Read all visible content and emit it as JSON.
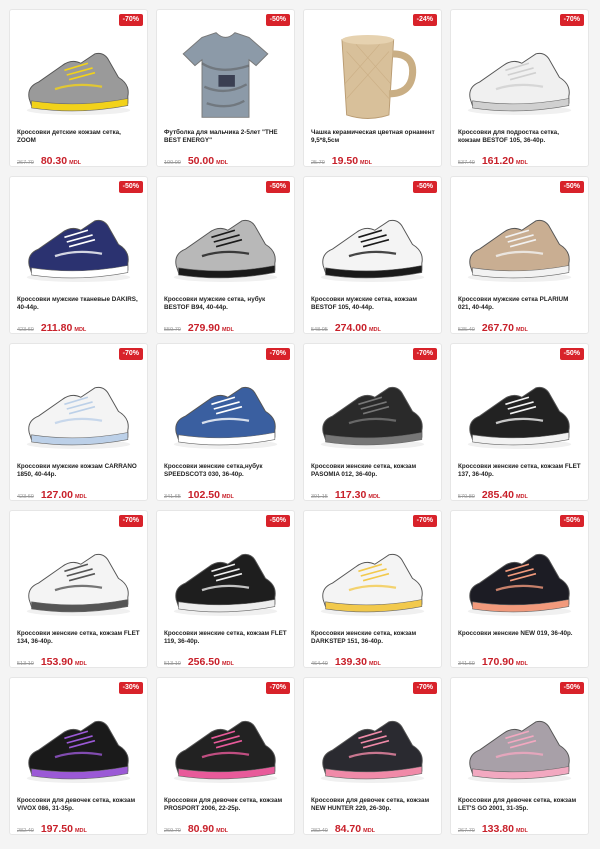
{
  "currency": "MDL",
  "products": [
    {
      "badge": "-70%",
      "title": "Кроссовки детские кожзам сетка, ZOOM",
      "old_price": "267.70",
      "price": "80.30",
      "icon": "kids-sneaker-silver-icon",
      "color": "#9a9a9a",
      "accent": "#f2d21a"
    },
    {
      "badge": "-50%",
      "title": "Футболка для мальчика 2-5лет \"THE BEST ENERGY\"",
      "old_price": "100.00",
      "price": "50.00",
      "icon": "tshirt-icon",
      "color": "#8c9aa8",
      "accent": "#3a3f52"
    },
    {
      "badge": "-24%",
      "title": "Чашка кeрамическая цветная орнамент 9,5*8,5см",
      "old_price": "25.70",
      "price": "19.50",
      "icon": "mug-icon",
      "color": "#d8c09a",
      "accent": "#c9ae84"
    },
    {
      "badge": "-70%",
      "title": "Кроссовки для подростка сетка, кожзам BESTOF 105, 36-40р.",
      "old_price": "537.40",
      "price": "161.20",
      "icon": "sneaker-white-icon",
      "color": "#f0f0f0",
      "accent": "#d0d0d0"
    },
    {
      "badge": "-50%",
      "title": "Кроссовки мужские тканевые DAKIRS, 40-44р.",
      "old_price": "423.60",
      "price": "211.80",
      "icon": "sneaker-navy-icon",
      "color": "#2b3270",
      "accent": "#ffffff"
    },
    {
      "badge": "-50%",
      "title": "Кроссовки мужские сетка, нубук BESTOF B94, 40-44р.",
      "old_price": "559.70",
      "price": "279.90",
      "icon": "sneaker-grey-black-icon",
      "color": "#b8b8b8",
      "accent": "#1a1a1a"
    },
    {
      "badge": "-50%",
      "title": "Кроссовки мужские сетка, кожзам BESTOF 105, 40-44р.",
      "old_price": "548.05",
      "price": "274.00",
      "icon": "sneaker-white-black-icon",
      "color": "#f4f4f4",
      "accent": "#1a1a1a"
    },
    {
      "badge": "-50%",
      "title": "Кроссовки мужские сетка PLARIUM 021, 40-44р.",
      "old_price": "535.40",
      "price": "267.70",
      "icon": "sneaker-beige-icon",
      "color": "#c9ae92",
      "accent": "#f2f2f2"
    },
    {
      "badge": "-70%",
      "title": "Кроссовки мужские кожзам CARRANO 1850, 40-44р.",
      "old_price": "423.60",
      "price": "127.00",
      "icon": "sneaker-white-chunky-icon",
      "color": "#f4f4f4",
      "accent": "#bcd0e8"
    },
    {
      "badge": "-70%",
      "title": "Кроссовки женские сетка,нубук SPEEDSCOT3 030, 36-40р.",
      "old_price": "341.65",
      "price": "102.50",
      "icon": "sneaker-blue-icon",
      "color": "#3a5fa0",
      "accent": "#ffffff"
    },
    {
      "badge": "-70%",
      "title": "Кроссовки женские сетка, кожзам PASOMIA 012, 36-40р.",
      "old_price": "391.15",
      "price": "117.30",
      "icon": "sneaker-black-icon",
      "color": "#2a2a2a",
      "accent": "#777777"
    },
    {
      "badge": "-50%",
      "title": "Кроссовки женские сетка, кожзам FLET 137, 36-40р.",
      "old_price": "570.80",
      "price": "285.40",
      "icon": "sneaker-black-white-icon",
      "color": "#222222",
      "accent": "#f2f2f2"
    },
    {
      "badge": "-70%",
      "title": "Кроссовки женские сетка, кожзам FLET 134, 36-40р.",
      "old_price": "513.10",
      "price": "153.90",
      "icon": "sneaker-white-grey-icon",
      "color": "#f4f4f4",
      "accent": "#555555"
    },
    {
      "badge": "-50%",
      "title": "Кроссовки женские сетка, кожзам FLET 119, 36-40р.",
      "old_price": "513.10",
      "price": "256.50",
      "icon": "sneaker-black-chunky-icon",
      "color": "#1e1e1e",
      "accent": "#eeeeee"
    },
    {
      "badge": "-70%",
      "title": "Кроссовки женские сетка, кожзам DARKSTEP 151, 36-40р.",
      "old_price": "464.40",
      "price": "139.30",
      "icon": "sneaker-white-color-icon",
      "color": "#f4f4f4",
      "accent": "#f2c94c"
    },
    {
      "badge": "-50%",
      "title": "Кроссовки женские NEW 019, 36-40р.",
      "old_price": "341.60",
      "price": "170.90",
      "icon": "sneaker-black-pink-icon",
      "color": "#1c1c24",
      "accent": "#f29a7c"
    },
    {
      "badge": "-30%",
      "title": "Кроссовки для девочек сетка, кожзам VIVOX 086, 31-35р.",
      "old_price": "282.40",
      "price": "197.50",
      "icon": "kids-sneaker-purple-icon",
      "color": "#1a1a1a",
      "accent": "#9b59d6"
    },
    {
      "badge": "-70%",
      "title": "Кроссовки для девочек сетка, кожзам PROSPORT 2006, 22-25р.",
      "old_price": "269.70",
      "price": "80.90",
      "icon": "kids-sneaker-pink-icon",
      "color": "#222222",
      "accent": "#e85a9a"
    },
    {
      "badge": "-70%",
      "title": "Кроссовки для девочек сетка, кожзам NEW HUNTER 229, 26-30р.",
      "old_price": "282.40",
      "price": "84.70",
      "icon": "kids-sneaker-black-pink-icon",
      "color": "#2a2a30",
      "accent": "#f08aa8"
    },
    {
      "badge": "-50%",
      "title": "Кроссовки для девочек сетка, кожзам LET'S GO 2001, 31-35р.",
      "old_price": "267.70",
      "price": "133.80",
      "icon": "kids-sneaker-grey-pink-icon",
      "color": "#a8a0a8",
      "accent": "#f2a8c0"
    }
  ]
}
